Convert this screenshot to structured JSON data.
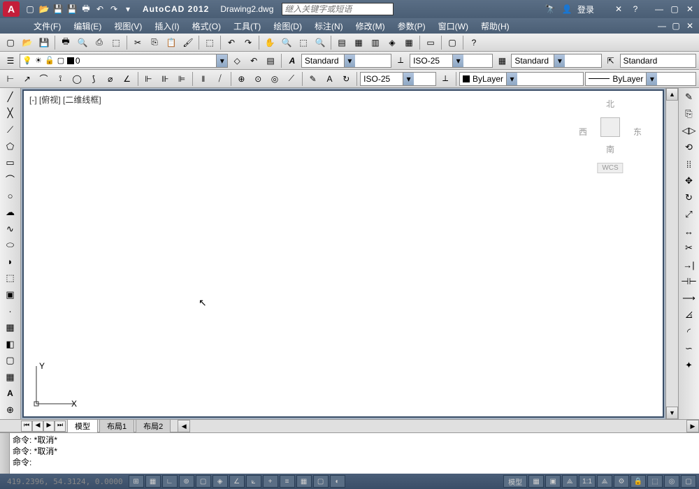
{
  "title": {
    "app": "AutoCAD 2012",
    "doc": "Drawing2.dwg",
    "search_placeholder": "继入关键字或短语",
    "login": "登录"
  },
  "menu": {
    "file": "文件(F)",
    "edit": "编辑(E)",
    "view": "视图(V)",
    "insert": "插入(I)",
    "format": "格式(O)",
    "tools": "工具(T)",
    "draw": "绘图(D)",
    "dimension": "标注(N)",
    "modify": "修改(M)",
    "param": "参数(P)",
    "window": "窗口(W)",
    "help": "帮助(H)"
  },
  "layer": {
    "name": "0"
  },
  "styles": {
    "text": "Standard",
    "dim": "ISO-25",
    "table": "Standard",
    "mleader": "Standard",
    "dim2": "ISO-25"
  },
  "props": {
    "color": "ByLayer",
    "ltype": "ByLayer"
  },
  "viewport": {
    "label": "[-] [俯视] [二维线框]"
  },
  "viewcube": {
    "n": "北",
    "s": "南",
    "e": "东",
    "w": "西",
    "wcs": "WCS"
  },
  "ucs": {
    "x": "X",
    "y": "Y"
  },
  "tabs": {
    "model": "模型",
    "layout1": "布局1",
    "layout2": "布局2"
  },
  "cmd": {
    "l1": "命令: *取消*",
    "l2": "命令: *取消*",
    "prompt": "命令:"
  },
  "status": {
    "coords": "419.2396, 54.3124, 0.0000",
    "model": "模型",
    "scale": "1:1"
  }
}
